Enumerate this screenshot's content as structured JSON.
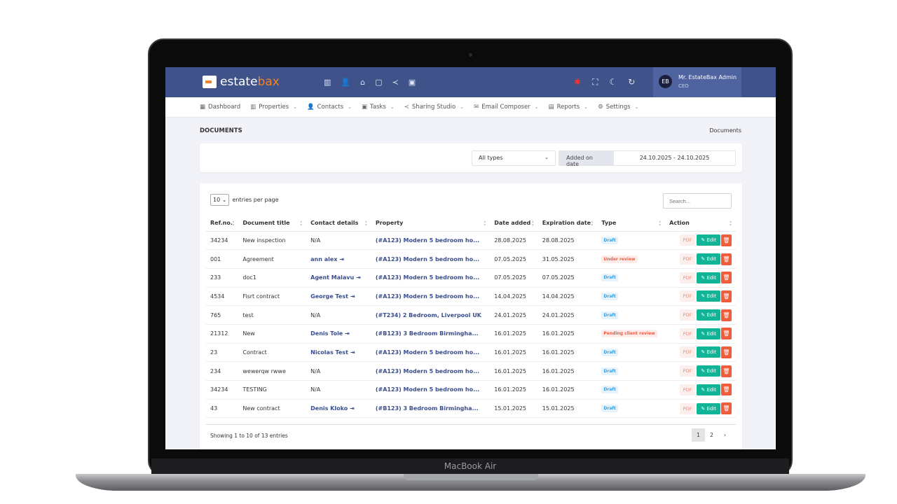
{
  "device": {
    "label": "MacBook Air"
  },
  "header": {
    "brand_a": "estate",
    "brand_b": "bax",
    "user_name": "Mr. EstateBax Admin",
    "user_role": "CEO",
    "icons": [
      "properties-icon",
      "contacts-icon",
      "home-icon",
      "document-search-icon",
      "share-icon",
      "board-icon"
    ],
    "right_icons": [
      "uk-flag-icon",
      "fullscreen-icon",
      "moon-icon",
      "refresh-icon"
    ]
  },
  "nav": [
    {
      "label": "Dashboard",
      "icon": "▦",
      "dropdown": false
    },
    {
      "label": "Properties",
      "icon": "▥",
      "dropdown": true
    },
    {
      "label": "Contacts",
      "icon": "👤",
      "dropdown": true
    },
    {
      "label": "Tasks",
      "icon": "▣",
      "dropdown": true
    },
    {
      "label": "Sharing Studio",
      "icon": "≺",
      "dropdown": true
    },
    {
      "label": "Email Composer",
      "icon": "✉",
      "dropdown": true
    },
    {
      "label": "Reports",
      "icon": "▤",
      "dropdown": true
    },
    {
      "label": "Settings",
      "icon": "⚙",
      "dropdown": true
    }
  ],
  "page": {
    "title": "DOCUMENTS",
    "breadcrumb": "Documents"
  },
  "filters": {
    "type_value": "All types",
    "date_label": "Added on date",
    "date_value": "24.10.2025 - 24.10.2025"
  },
  "table_controls": {
    "entries_value": "10",
    "entries_label": "entries per page",
    "search_placeholder": "Search..."
  },
  "columns": [
    "Ref.no.",
    "Document title",
    "Contact details",
    "Property",
    "Date added",
    "Expiration date",
    "Type",
    "Action"
  ],
  "rows": [
    {
      "ref": "34234",
      "title": "New inspection",
      "contact": "N/A",
      "property": "(#A123) Modern 5 bedroom ho...",
      "added": "28.08.2025",
      "expires": "28.08.2025",
      "type": "Draft"
    },
    {
      "ref": "001",
      "title": "Agreement",
      "contact": "ann alex",
      "property": "(#A123) Modern 5 bedroom ho...",
      "added": "07.05.2025",
      "expires": "31.05.2025",
      "type": "Under review"
    },
    {
      "ref": "233",
      "title": "doc1",
      "contact": "Agent Malavu",
      "property": "(#A123) Modern 5 bedroom ho...",
      "added": "07.05.2025",
      "expires": "07.05.2025",
      "type": "Draft"
    },
    {
      "ref": "4534",
      "title": "Fisrt contract",
      "contact": "George Test",
      "property": "(#A123) Modern 5 bedroom ho...",
      "added": "14.04.2025",
      "expires": "14.04.2025",
      "type": "Draft"
    },
    {
      "ref": "765",
      "title": "test",
      "contact": "N/A",
      "property": "(#T234) 2 Bedroom, Liverpool UK",
      "added": "24.01.2025",
      "expires": "24.01.2025",
      "type": "Draft"
    },
    {
      "ref": "21312",
      "title": "New",
      "contact": "Denis Tole",
      "property": "(#B123) 3 Bedroom Birmingha...",
      "added": "16.01.2025",
      "expires": "16.01.2025",
      "type": "Pending client review"
    },
    {
      "ref": "23",
      "title": "Contract",
      "contact": "Nicolas Test",
      "property": "(#A123) Modern 5 bedroom ho...",
      "added": "16.01.2025",
      "expires": "16.01.2025",
      "type": "Draft"
    },
    {
      "ref": "234",
      "title": "wewerqw rwwe",
      "contact": "N/A",
      "property": "(#A123) Modern 5 bedroom ho...",
      "added": "16.01.2025",
      "expires": "16.01.2025",
      "type": "Draft"
    },
    {
      "ref": "34234",
      "title": "TESTING",
      "contact": "N/A",
      "property": "(#A123) Modern 5 bedroom ho...",
      "added": "16.01.2025",
      "expires": "16.01.2025",
      "type": "Draft"
    },
    {
      "ref": "43",
      "title": "New contract",
      "contact": "Denis Kloko",
      "property": "(#B123) 3 Bedroom Birmingha...",
      "added": "15.01.2025",
      "expires": "15.01.2025",
      "type": "Draft"
    }
  ],
  "actions": {
    "pdf": "PDF",
    "edit": "Edit"
  },
  "colors": {
    "header": "#3f5289",
    "draft_bg": "#e6f3fd",
    "draft_fg": "#3a9ee6",
    "review_bg": "#fdecea",
    "review_fg": "#ef5d3d",
    "edit": "#11b497",
    "delete": "#ef5d3d"
  },
  "footer": {
    "info": "Showing 1 to 10 of 13 entries",
    "pages": [
      "1",
      "2",
      "›"
    ]
  }
}
